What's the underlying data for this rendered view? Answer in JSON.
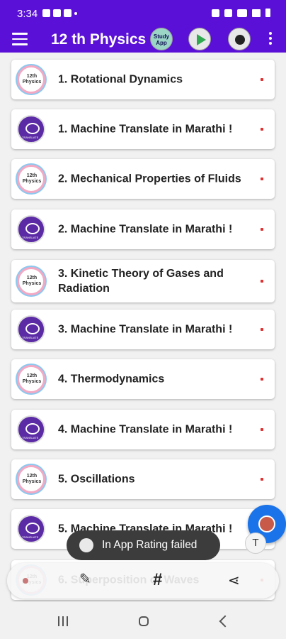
{
  "status_bar": {
    "time": "3:34"
  },
  "app_bar": {
    "title": "12 th Physics",
    "study_app_label": "Study App"
  },
  "items": [
    {
      "label": "1. Rotational Dynamics",
      "logo": "physics-logo"
    },
    {
      "label": "1. Machine Translate in Marathi !",
      "logo": "translate-logo"
    },
    {
      "label": "2. Mechanical Properties of Fluids",
      "logo": "physics-logo"
    },
    {
      "label": "2. Machine Translate in Marathi !",
      "logo": "translate-logo"
    },
    {
      "label": "3. Kinetic Theory of Gases and Radiation",
      "logo": "physics-logo"
    },
    {
      "label": "3. Machine Translate in Marathi !",
      "logo": "translate-logo"
    },
    {
      "label": "4. Thermodynamics",
      "logo": "physics-logo"
    },
    {
      "label": "4. Machine Translate in Marathi !",
      "logo": "translate-logo"
    },
    {
      "label": "5. Oscillations",
      "logo": "physics-logo"
    },
    {
      "label": "5. Machine Translate in Marathi !",
      "logo": "translate-logo"
    },
    {
      "label": "6. Superposition of Waves",
      "logo": "physics-logo"
    }
  ],
  "toast": {
    "text": "In App Rating failed"
  },
  "font_button": {
    "label": "T"
  },
  "colors": {
    "primary": "#5a10d6",
    "arrow": "#e23030",
    "fab": "#1a73e8"
  }
}
